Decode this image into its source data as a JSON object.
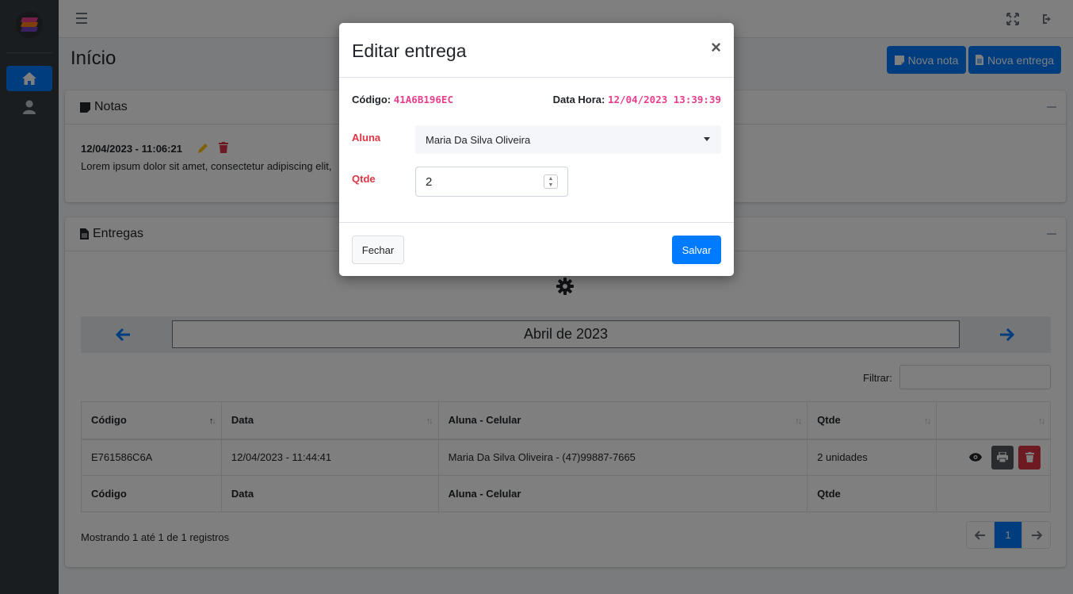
{
  "page": {
    "title": "Início"
  },
  "header_actions": {
    "nova_nota": "Nova nota",
    "nova_entrega": "Nova entrega"
  },
  "notas": {
    "title": "Notas",
    "items": [
      {
        "date": "12/04/2023 - 11:06:21",
        "text": "Lorem ipsum dolor sit amet, consectetur adipiscing elit,"
      }
    ]
  },
  "entregas": {
    "title": "Entregas",
    "month": "Abril de 2023",
    "filter_label": "Filtrar:",
    "filter_value": "",
    "columns": [
      "Código",
      "Data",
      "Aluna - Celular",
      "Qtde"
    ],
    "rows": [
      {
        "codigo": "E761586C6A",
        "data": "12/04/2023 - 11:44:41",
        "aluna": "Maria Da Silva Oliveira - (47)99887-7665",
        "qtde": "2 unidades"
      }
    ],
    "info": "Mostrando 1 até 1 de 1 registros",
    "current_page": "1"
  },
  "modal": {
    "title": "Editar entrega",
    "close": "×",
    "codigo_label": "Código:",
    "codigo_value": "41A6B196EC",
    "datahora_label": "Data Hora:",
    "datahora_value": "12/04/2023 13:39:39",
    "aluna_label": "Aluna",
    "aluna_value": "Maria Da Silva Oliveira",
    "qtde_label": "Qtde",
    "qtde_value": "2",
    "fechar": "Fechar",
    "salvar": "Salvar"
  },
  "colors": {
    "primary": "#007bff",
    "danger": "#dc3545",
    "sidebar": "#343a40",
    "code": "#e83e8c"
  }
}
